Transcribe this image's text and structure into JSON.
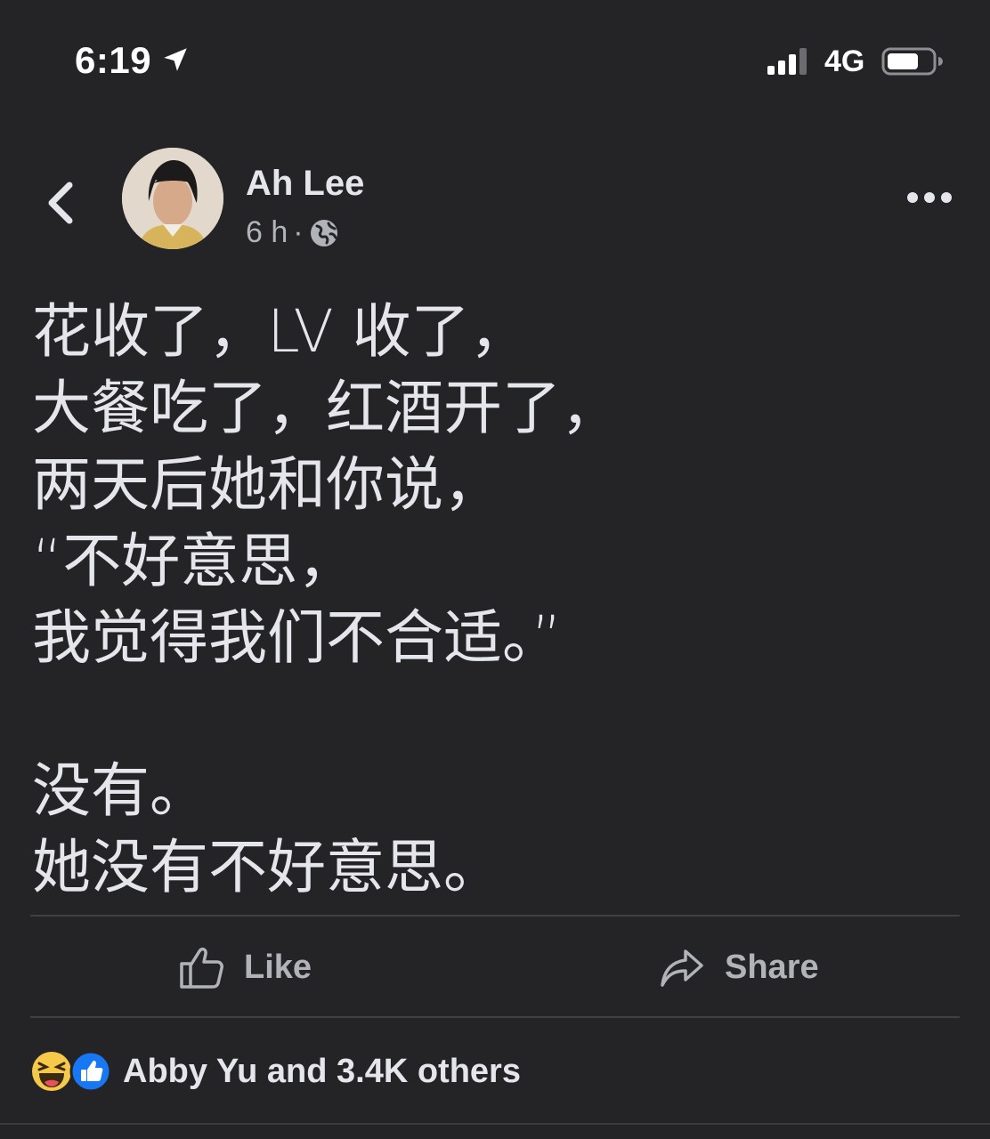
{
  "status_bar": {
    "time": "6:19",
    "network": "4G"
  },
  "post": {
    "author": "Ah Lee",
    "time_ago": "6 h",
    "separator": "·",
    "lines": [
      "花收了，LV 收了，",
      "大餐吃了，红酒开了，",
      "两天后她和你说，",
      "“不好意思，",
      "我觉得我们不合适。”",
      "",
      "没有。",
      "她没有不好意思。"
    ]
  },
  "actions": {
    "like_label": "Like",
    "share_label": "Share"
  },
  "reactions": {
    "summary": "Abby Yu and 3.4K others"
  },
  "icons": {
    "location": "location-arrow-icon",
    "signal": "signal-bars-icon",
    "battery": "battery-icon",
    "back": "chevron-left-icon",
    "privacy": "globe-icon",
    "more": "more-dots-icon",
    "like": "thumbs-up-icon",
    "share": "share-arrow-icon",
    "reaction_haha": "laughing-emoji-icon",
    "reaction_like": "like-reaction-icon"
  },
  "colors": {
    "background": "#242427",
    "text": "#e4e6eb",
    "secondary": "#b0b3b8",
    "like_blue": "#1877f2"
  }
}
